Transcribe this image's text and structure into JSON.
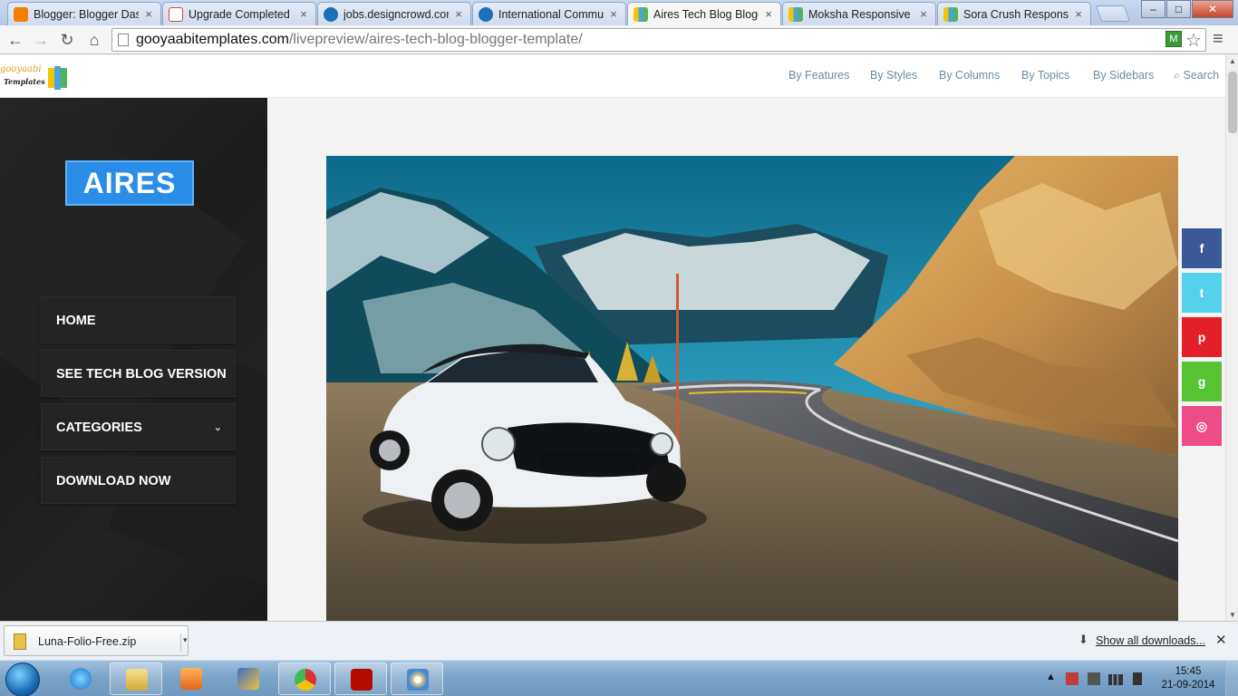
{
  "browser": {
    "tabs": [
      {
        "label": "Blogger: Blogger Dashb",
        "icon": "blogger-icon",
        "color": "#f57d00",
        "active": false
      },
      {
        "label": "Upgrade Completed &",
        "icon": "gmail-icon",
        "color": "#d44638",
        "active": false
      },
      {
        "label": "jobs.designcrowd.com",
        "icon": "designcrowd-icon",
        "color": "#1d6fb8",
        "active": false
      },
      {
        "label": "International Commun",
        "icon": "designcrowd-icon",
        "color": "#1d6fb8",
        "active": false
      },
      {
        "label": "Aires Tech Blog Blogg",
        "icon": "gooyaabi-icon",
        "color": "#4aa3df",
        "active": true
      },
      {
        "label": "Moksha Responsive Bl",
        "icon": "gooyaabi-icon",
        "color": "#4aa3df",
        "active": false
      },
      {
        "label": "Sora Crush Responsive",
        "icon": "gooyaabi-icon",
        "color": "#4aa3df",
        "active": false
      }
    ],
    "tab_close": "×",
    "window_controls": {
      "minimize": "‒",
      "maximize": "□",
      "close": "✕"
    },
    "nav": {
      "back": "←",
      "forward": "→",
      "reload": "↻",
      "home": "⌂"
    },
    "url_domain": "gooyaabitemplates.com",
    "url_path": "/livepreview/aires-tech-blog-blogger-template/",
    "extension_label": "M",
    "star": "☆",
    "menu": "≡"
  },
  "site": {
    "logo_text": "gooyaabi",
    "logo_text2": "Templates",
    "nav": [
      "By Features",
      "By Styles",
      "By Columns",
      "By Topics",
      "By Sidebars"
    ],
    "search_label": "Search",
    "search_glyph": "⌕"
  },
  "sidebar": {
    "brand": "AIRES",
    "menu": [
      {
        "label": "HOME",
        "has_dropdown": false
      },
      {
        "label": "SEE TECH BLOG VERSION",
        "has_dropdown": false
      },
      {
        "label": "CATEGORIES",
        "has_dropdown": true
      },
      {
        "label": "DOWNLOAD NOW",
        "has_dropdown": false
      }
    ],
    "dropdown_glyph": "⌄"
  },
  "share": [
    {
      "network": "facebook",
      "glyph": "f",
      "color": "#3b5998"
    },
    {
      "network": "twitter",
      "glyph": "t",
      "color": "#55d0ed"
    },
    {
      "network": "pinterest",
      "glyph": "p",
      "color": "#e3202a"
    },
    {
      "network": "github",
      "glyph": "g",
      "color": "#57c232"
    },
    {
      "network": "dribbble",
      "glyph": "◎",
      "color": "#ee4c88"
    }
  ],
  "downloads": {
    "file": "Luna-Folio-Free.zip",
    "caret": "▾",
    "arrow": "⬇",
    "show_all": "Show all downloads...",
    "close": "✕"
  },
  "taskbar": {
    "apps": [
      "ie-icon",
      "explorer-icon",
      "media-player-icon",
      "paint-tool-icon",
      "chrome-icon",
      "acrobat-icon",
      "paint-icon"
    ],
    "tray_arrow": "▲",
    "time": "15:45",
    "date": "21-09-2014"
  }
}
